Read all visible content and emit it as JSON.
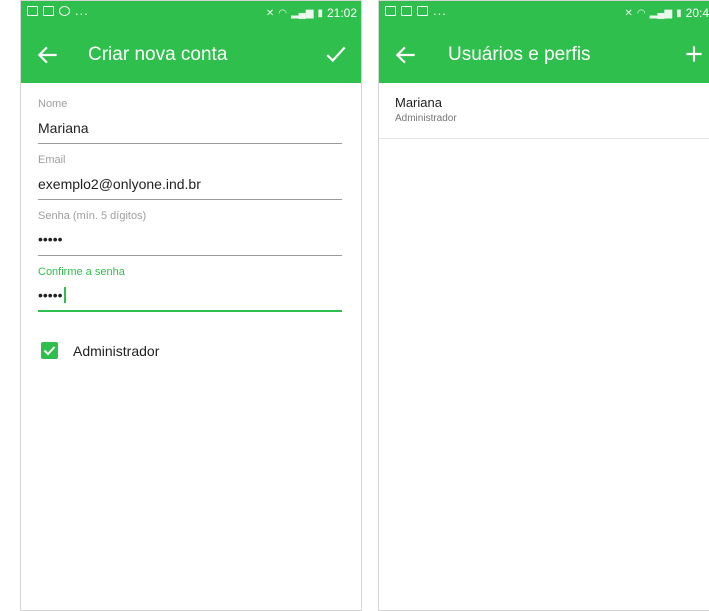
{
  "colors": {
    "accent": "#2fbf4c",
    "text_primary": "#212121",
    "text_secondary": "#757575",
    "hint": "#9e9e9e"
  },
  "left_screen": {
    "status_bar": {
      "icons": [
        "image-icon",
        "facebook-icon",
        "whatsapp-icon"
      ],
      "overflow": "...",
      "time": "21:02"
    },
    "app_bar": {
      "back_icon": "arrow-left-icon",
      "title": "Criar nova conta",
      "action_icon": "check-icon"
    },
    "form": {
      "name": {
        "label": "Nome",
        "value": "Mariana"
      },
      "email": {
        "label": "Email",
        "value": "exemplo2@onlyone.ind.br"
      },
      "password": {
        "label": "Senha (mín. 5 dígitos)",
        "value": "•••••"
      },
      "confirm_password": {
        "label": "Confirme a senha",
        "value": "•••••",
        "focused": true
      },
      "admin_checkbox": {
        "label": "Administrador",
        "checked": true
      }
    }
  },
  "right_screen": {
    "status_bar": {
      "icons": [
        "image-icon",
        "facebook-icon",
        "instagram-icon"
      ],
      "overflow": "...",
      "time": "20:4"
    },
    "app_bar": {
      "back_icon": "arrow-left-icon",
      "title": "Usuários e perfis",
      "action_icon": "plus-icon"
    },
    "users": [
      {
        "name": "Mariana",
        "role": "Administrador"
      }
    ]
  }
}
